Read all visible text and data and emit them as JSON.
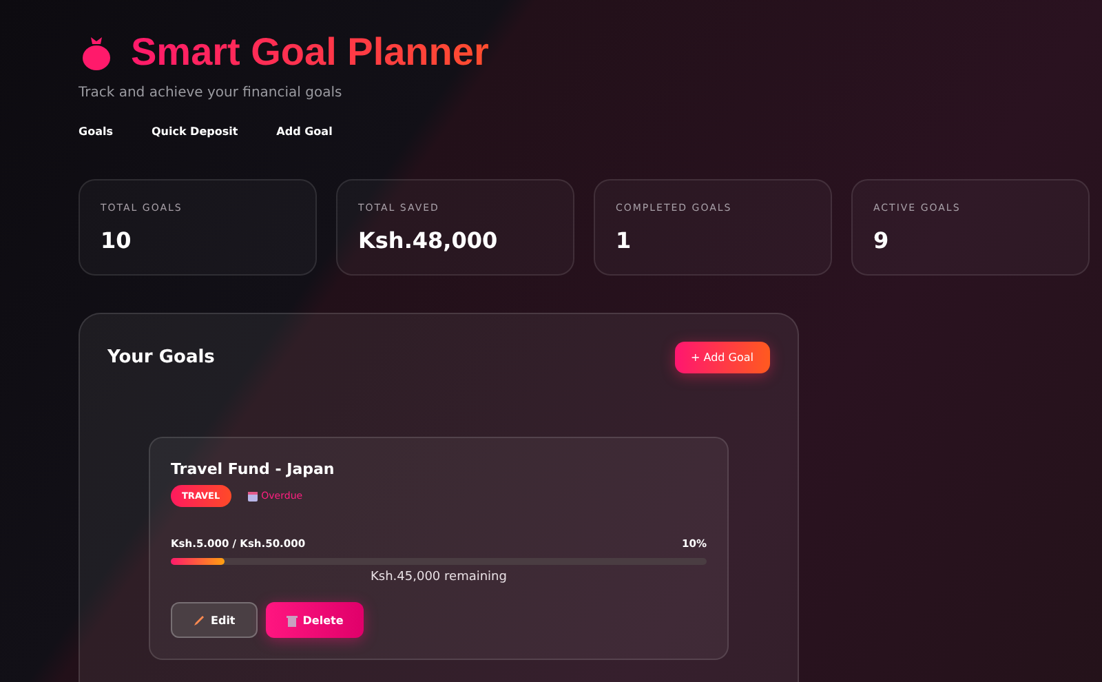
{
  "header": {
    "title": "Smart Goal Planner",
    "subtitle": "Track and achieve your financial goals"
  },
  "nav": [
    {
      "label": "Goals"
    },
    {
      "label": "Quick Deposit"
    },
    {
      "label": "Add Goal"
    }
  ],
  "stats": [
    {
      "label": "TOTAL GOALS",
      "value": "10"
    },
    {
      "label": "TOTAL SAVED",
      "value": "Ksh.48,000"
    },
    {
      "label": "COMPLETED GOALS",
      "value": "1"
    },
    {
      "label": "ACTIVE GOALS",
      "value": "9"
    }
  ],
  "goals_panel": {
    "title": "Your Goals",
    "add_button": "+ Add Goal",
    "goals": [
      {
        "name": "Travel Fund - Japan",
        "category": "TRAVEL",
        "status": "Overdue",
        "amounts": "Ksh.5.000 / Ksh.50.000",
        "percent": "10%",
        "level": 0.1,
        "remaining": "Ksh.45,000 remaining",
        "actions": [
          {
            "kind": "edit",
            "label": "Edit"
          },
          {
            "kind": "delete",
            "label": "Delete"
          }
        ]
      }
    ]
  }
}
